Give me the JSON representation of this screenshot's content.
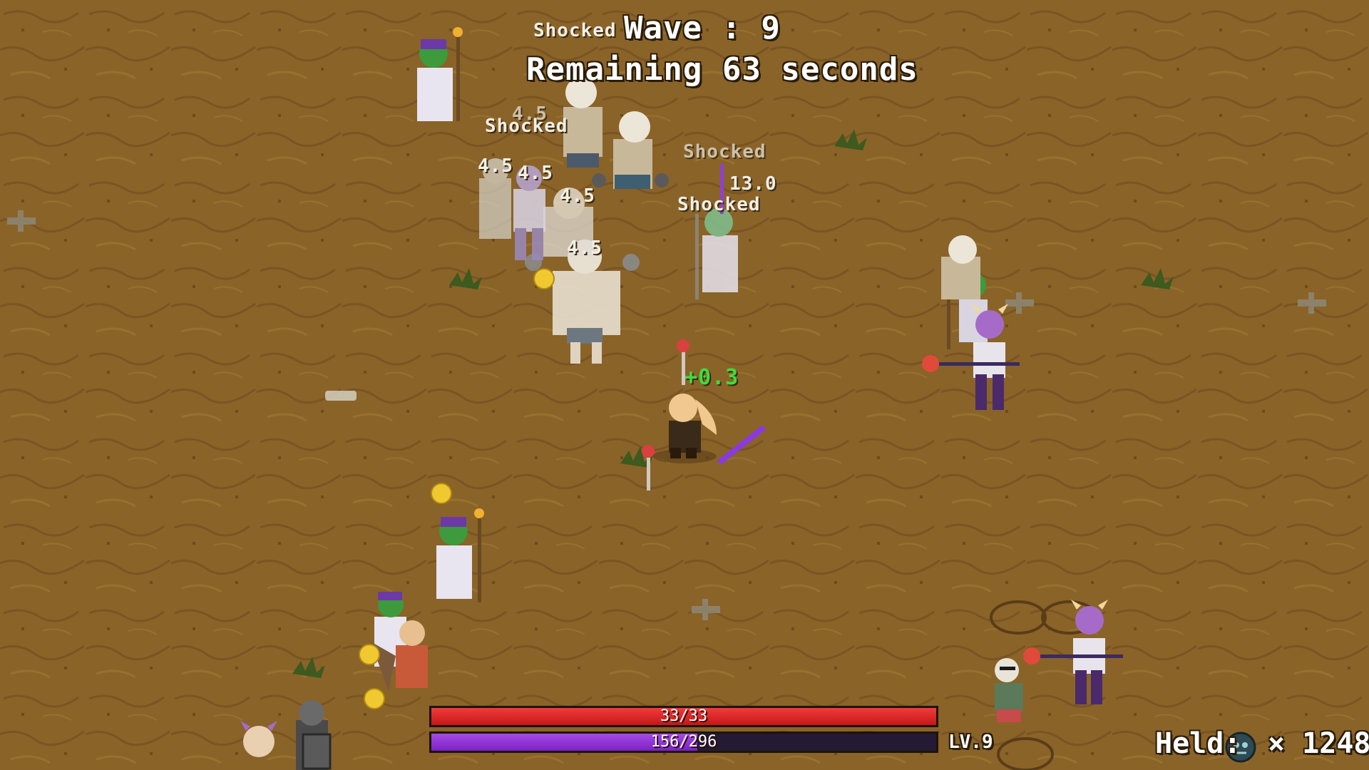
{
  "hud": {
    "wave": "Wave : 9",
    "timer": "Remaining 63 seconds",
    "hp": {
      "text": "33/33",
      "current": 33,
      "max": 33
    },
    "xp": {
      "text": "156/296",
      "current": 156,
      "max": 296
    },
    "level": "LV.9",
    "held": {
      "label": "Held:",
      "icon": "soul-orb-icon",
      "count": "× 1248"
    }
  },
  "floating_texts": [
    {
      "text": "Shocked"
    },
    {
      "text": "Shocked"
    },
    {
      "text": "Shocked"
    },
    {
      "text": "Shocked"
    },
    {
      "text": "13.0"
    },
    {
      "text": "4.5"
    },
    {
      "text": "4.5"
    },
    {
      "text": "4.5"
    },
    {
      "text": "4.5"
    },
    {
      "text": "4.5"
    },
    {
      "text": "+0.3"
    }
  ],
  "colors": {
    "ground": "#8a6329",
    "hp": "#e12a2a",
    "xp": "#8b35d6",
    "heal_text": "#3fdc3f"
  }
}
